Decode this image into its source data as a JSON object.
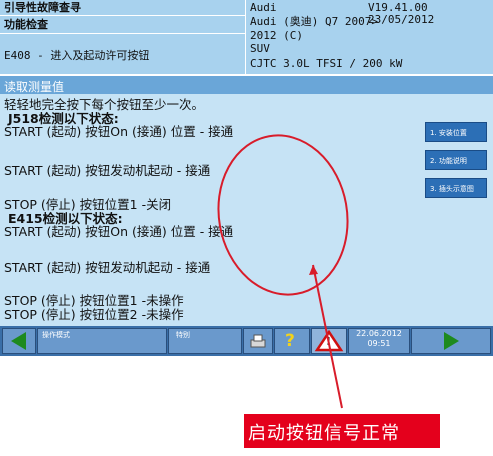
{
  "header": {
    "left_title": "引导性故障查寻",
    "left_sub": "功能检查",
    "left_code": "E408 - 进入及起动许可按钮",
    "brand": "Audi",
    "version": "V19.41.00 23/05/2012",
    "model": "Audi (奥迪) Q7 2007>",
    "year": "2012 (C)",
    "body_type": "SUV",
    "engine": "CJTC 3.0L TFSI / 200 kW"
  },
  "section": {
    "title": "读取测量值"
  },
  "lines": [
    "轻轻地完全按下每个按钮至少一次。",
    " J518检测以下状态:",
    "START (起动) 按钮On (接通) 位置 - 接通",
    "START (起动) 按钮发动机起动 - 接通",
    "STOP (停止) 按钮位置1 -关闭",
    " E415检测以下状态:",
    "START (起动) 按钮On (接通) 位置 - 接通",
    "START (起动) 按钮发动机起动 - 接通",
    "STOP (停止) 按钮位置1 -未操作",
    "STOP (停止) 按钮位置2 -未操作"
  ],
  "side_buttons": [
    "1. 安装位置",
    "2. 功能说明",
    "3. 插头示意图"
  ],
  "toolbar": {
    "mode_label": "操作模式",
    "special_label": "特别",
    "help_glyph": "?",
    "warning_glyph": "!",
    "date": "22.06.2012",
    "time": "09:51"
  },
  "callout": {
    "text": "启动按钮信号正常"
  },
  "colors": {
    "header": "#a8d2ee",
    "panel": "#c6e3f5",
    "section": "#6aa6d8",
    "toolbar": "#3a6fa8",
    "callout": "#e4001c",
    "arrow": "#1e8a1e"
  }
}
